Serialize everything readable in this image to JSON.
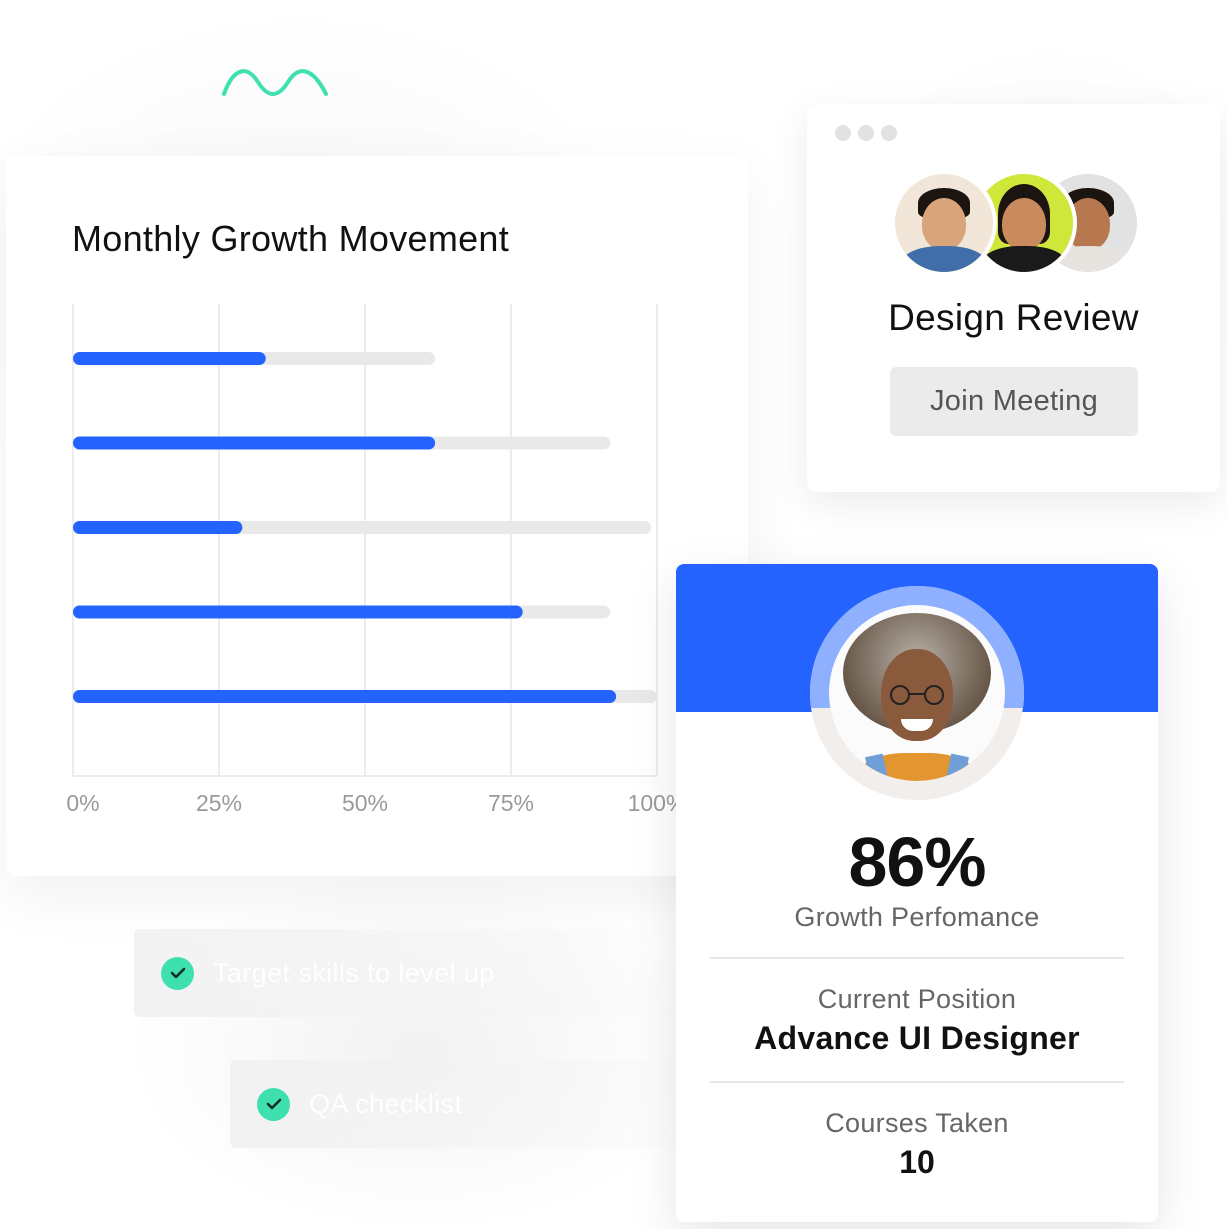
{
  "decoration": {
    "squiggle_color": "#3ee0b0"
  },
  "chart_card": {
    "title": "Monthly Growth Movement",
    "chart_data": {
      "type": "bar",
      "orientation": "horizontal",
      "categories": [
        "",
        "",
        "",
        "",
        ""
      ],
      "series": [
        {
          "values": [
            33,
            62,
            29,
            77,
            93
          ],
          "color": "#2563ff"
        },
        {
          "values": [
            62,
            92,
            99,
            92,
            103
          ],
          "color": "#e9e9e9"
        }
      ],
      "xticks": [
        "0%",
        "25%",
        "50%",
        "75%",
        "100%"
      ],
      "xlim": [
        0,
        100
      ],
      "grid": true,
      "legend": "none"
    }
  },
  "meeting_card": {
    "window_dots": 3,
    "participants": [
      {
        "name": "avatar-participant-1",
        "bg": "#f1e6d8",
        "skin": "#d9a47a",
        "shirt": "#3f6ea8"
      },
      {
        "name": "avatar-participant-2",
        "bg": "#cfe63a",
        "skin": "#c98a5e",
        "shirt": "#1a1a1a"
      },
      {
        "name": "avatar-participant-3",
        "bg": "#e2e2e2",
        "skin": "#b7784f",
        "shirt": "#e7e4df"
      }
    ],
    "title": "Design Review",
    "join_label": "Join Meeting"
  },
  "profile_card": {
    "accent": "#2563ff",
    "performance_value": "86%",
    "performance_label": "Growth Perfomance",
    "position_label": "Current Position",
    "position_value": "Advance UI Designer",
    "courses_label": "Courses Taken",
    "courses_value": "10"
  },
  "checklist": [
    {
      "label": "Target skills to level up",
      "checked": true
    },
    {
      "label": "QA checklist",
      "checked": true
    }
  ],
  "colors": {
    "check": "#3ee0b0",
    "bar_fill": "#2563ff",
    "bar_track": "#e9e9e9"
  }
}
